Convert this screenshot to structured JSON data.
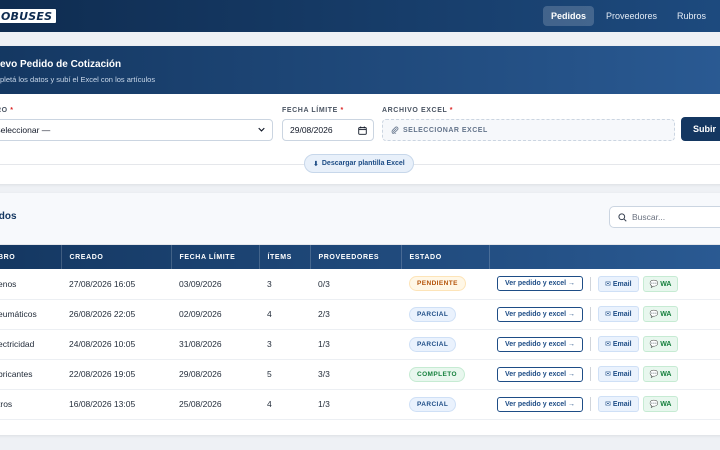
{
  "app": {
    "logo_text": "OBUSES"
  },
  "nav": {
    "items": [
      "Pedidos",
      "Proveedores",
      "Rubros"
    ],
    "active": "Pedidos"
  },
  "form": {
    "title": "evo Pedido de Cotización",
    "subtitle": "pletá los datos y subí el Excel con los artículos",
    "rubro_label": "RO",
    "rubro_value": "Seleccionar —",
    "fecha_label": "FECHA LÍMITE",
    "fecha_value": "29/08/2026",
    "archivo_label": "ARCHIVO EXCEL",
    "archivo_placeholder": "SELECCIONAR EXCEL",
    "submit_label": "Subir",
    "download_label": "Descargar plantilla Excel"
  },
  "list": {
    "title": "idos",
    "search_placeholder": "Buscar...",
    "columns": [
      "BRO",
      "CREADO",
      "FECHA LÍMITE",
      "ÍTEMS",
      "PROVEEDORES",
      "ESTADO",
      ""
    ],
    "rows": [
      {
        "rubro": "enos",
        "creado": "27/08/2026 16:05",
        "fecha": "03/09/2026",
        "items": "3",
        "prov": "0/3",
        "estado": "PENDIENTE"
      },
      {
        "rubro": "eumáticos",
        "creado": "26/08/2026 22:05",
        "fecha": "02/09/2026",
        "items": "4",
        "prov": "2/3",
        "estado": "PARCIAL"
      },
      {
        "rubro": "ectricidad",
        "creado": "24/08/2026 10:05",
        "fecha": "31/08/2026",
        "items": "3",
        "prov": "1/3",
        "estado": "PARCIAL"
      },
      {
        "rubro": "bricantes",
        "creado": "22/08/2026 19:05",
        "fecha": "29/08/2026",
        "items": "5",
        "prov": "3/3",
        "estado": "COMPLETO"
      },
      {
        "rubro": "tros",
        "creado": "16/08/2026 13:05",
        "fecha": "25/08/2026",
        "items": "4",
        "prov": "1/3",
        "estado": "PARCIAL"
      }
    ],
    "actions": {
      "ver": "Ver pedido y excel →",
      "email": "Email",
      "wa": "WA"
    }
  },
  "colors": {
    "brand": "#143761",
    "pendiente": "#b45309",
    "parcial": "#1e4d86",
    "completo": "#15803d"
  }
}
